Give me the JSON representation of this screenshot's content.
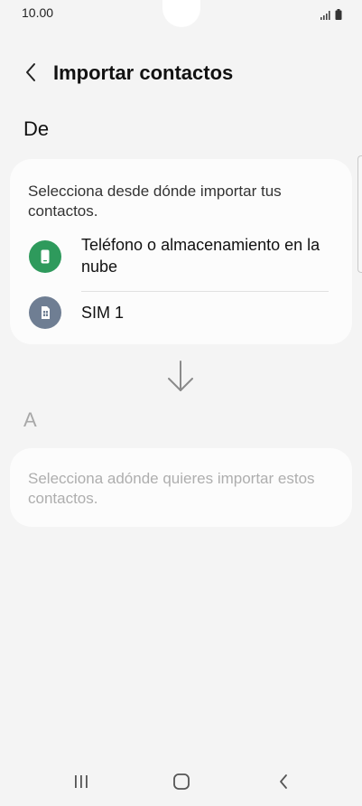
{
  "status_bar": {
    "time": "10.00"
  },
  "header": {
    "title": "Importar contactos"
  },
  "from_section": {
    "label": "De",
    "hint": "Selecciona desde dónde importar tus contactos.",
    "options": [
      {
        "label": "Teléfono o almacenamiento en la nube",
        "icon": "phone-icon",
        "color": "#2e9a5c"
      },
      {
        "label": "SIM 1",
        "icon": "sim-card-icon",
        "color": "#6f7e93"
      }
    ]
  },
  "to_section": {
    "label": "A",
    "hint": "Selecciona adónde quieres importar estos contactos."
  },
  "icons": {
    "transfer_direction": "arrow-down-icon"
  },
  "navigation_bar": {
    "buttons": [
      "recents-icon",
      "home-icon",
      "back-icon"
    ]
  }
}
